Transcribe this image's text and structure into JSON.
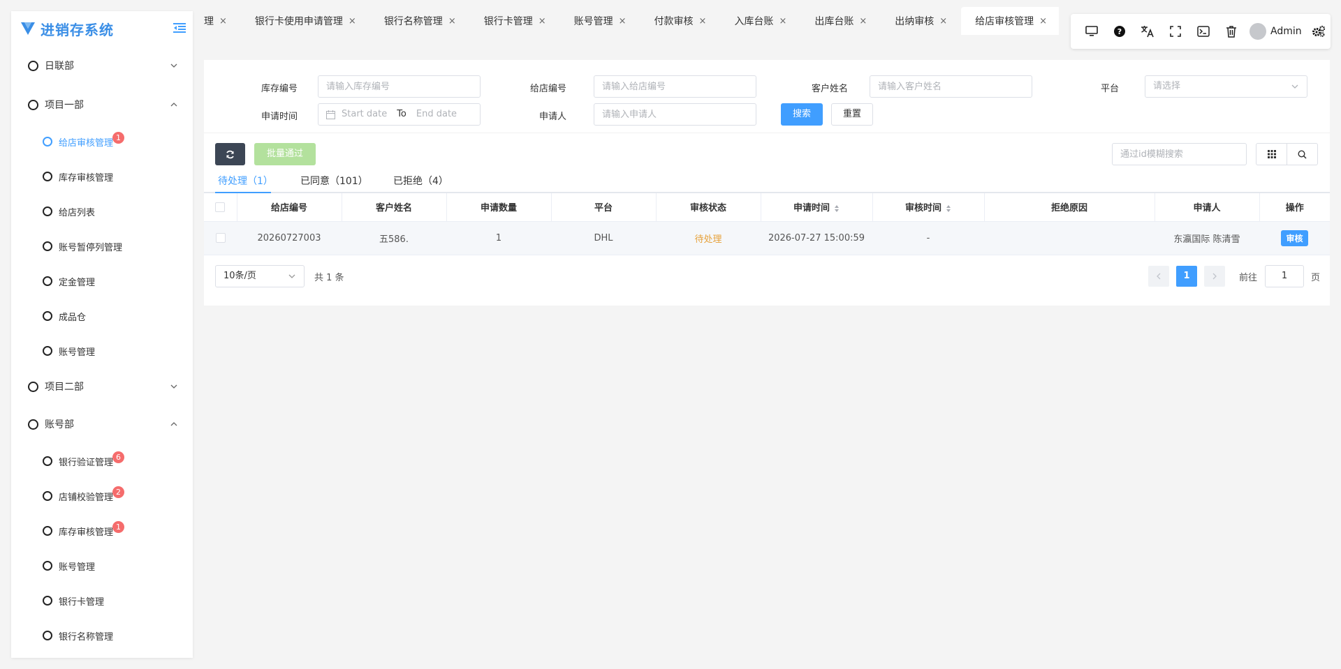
{
  "app": {
    "title": "进销存系统"
  },
  "sidebar": {
    "groups": [
      {
        "label": "日联部",
        "expanded": false
      },
      {
        "label": "项目一部",
        "expanded": true,
        "items": [
          {
            "label": "给店审核管理",
            "badge": "1",
            "active": true
          },
          {
            "label": "库存审核管理"
          },
          {
            "label": "给店列表"
          },
          {
            "label": "账号暂停列管理"
          },
          {
            "label": "定金管理"
          },
          {
            "label": "成品仓"
          },
          {
            "label": "账号管理"
          }
        ]
      },
      {
        "label": "项目二部",
        "expanded": false
      },
      {
        "label": "账号部",
        "expanded": true,
        "items": [
          {
            "label": "银行验证管理",
            "badge": "6"
          },
          {
            "label": "店铺校验管理",
            "badge": "2"
          },
          {
            "label": "库存审核管理",
            "badge": "1"
          },
          {
            "label": "账号管理"
          },
          {
            "label": "银行卡管理"
          },
          {
            "label": "银行名称管理"
          }
        ]
      }
    ]
  },
  "tabs": [
    {
      "label": "理"
    },
    {
      "label": "银行卡使用申请管理"
    },
    {
      "label": "银行名称管理"
    },
    {
      "label": "银行卡管理"
    },
    {
      "label": "账号管理"
    },
    {
      "label": "付款审核"
    },
    {
      "label": "入库台账"
    },
    {
      "label": "出库台账"
    },
    {
      "label": "出纳审核"
    },
    {
      "label": "给店审核管理",
      "active": true
    }
  ],
  "toolbar": {
    "user_name": "Admin",
    "close_glyph": "×"
  },
  "filters": {
    "stock_no": {
      "label": "库存编号",
      "placeholder": "请输入库存编号"
    },
    "store_no": {
      "label": "给店编号",
      "placeholder": "请输入给店编号"
    },
    "customer": {
      "label": "客户姓名",
      "placeholder": "请输入客户姓名"
    },
    "platform": {
      "label": "平台",
      "placeholder": "请选择"
    },
    "apply_time": {
      "label": "申请时间",
      "start": "Start date",
      "to": "To",
      "end": "End date"
    },
    "applicant": {
      "label": "申请人",
      "placeholder": "请输入申请人"
    },
    "search_label": "搜索",
    "reset_label": "重置"
  },
  "actions": {
    "batch_approve": "批量通过",
    "id_search_placeholder": "通过id模糊搜索"
  },
  "status_tabs": [
    {
      "label": "待处理（1）",
      "active": true
    },
    {
      "label": "已同意（101）"
    },
    {
      "label": "已拒绝（4）"
    }
  ],
  "table": {
    "columns": [
      "给店编号",
      "客户姓名",
      "申请数量",
      "平台",
      "审核状态",
      "申请时间",
      "审核时间",
      "拒绝原因",
      "申请人",
      "操作"
    ],
    "rows": [
      {
        "store_no": "20260727003",
        "customer": "五586.",
        "qty": "1",
        "platform": "DHL",
        "status": "待处理",
        "apply_time": "2026-07-27 15:00:59",
        "audit_time": "-",
        "reject_reason": "",
        "applicant": "东瀛国际 陈清雪",
        "action": "审核"
      }
    ]
  },
  "pagination": {
    "page_size": "10条/页",
    "total": "共 1 条",
    "current": "1",
    "goto_label": "前往",
    "goto_value": "1",
    "page_suffix": "页"
  },
  "colors": {
    "primary": "#409eff",
    "warning": "#e6a23c",
    "danger": "#f56c6c",
    "success_light": "#b3e19d"
  }
}
